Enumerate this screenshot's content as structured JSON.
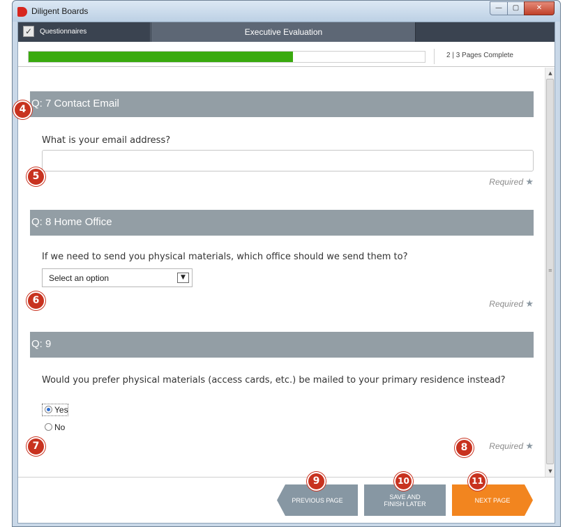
{
  "window": {
    "title": "Diligent Boards",
    "min_glyph": "—",
    "max_glyph": "▢",
    "close_glyph": "✕"
  },
  "navbar": {
    "section_label": "Questionnaires",
    "title": "Executive Evaluation",
    "check_glyph": "✓"
  },
  "progress": {
    "fraction_complete": 0.667,
    "label": "2 | 3   Pages Complete"
  },
  "questions": [
    {
      "header": "Q: 7  Contact Email",
      "prompt": "What is your email address?",
      "input_value": "",
      "required": "Required"
    },
    {
      "header": "Q: 8  Home Office",
      "prompt": "If we need to send you physical materials, which office should we send them to?",
      "select_value": "Select an option",
      "required": "Required"
    },
    {
      "header": "Q: 9",
      "prompt": "Would you prefer physical materials (access cards, etc.) be mailed to your primary residence instead?",
      "options": [
        "Yes",
        "No"
      ],
      "selected": "Yes",
      "required": "Required"
    }
  ],
  "required_star": "★",
  "buttons": {
    "previous": "PREVIOUS PAGE",
    "save_line1": "SAVE AND",
    "save_line2": "FINISH LATER",
    "next": "NEXT PAGE"
  },
  "callouts": [
    "4",
    "5",
    "6",
    "7",
    "8",
    "9",
    "10",
    "11"
  ],
  "colors": {
    "progress": "#3aaa0f",
    "header": "#939ea5",
    "navbar": "#3a4350",
    "next_button": "#f2851f",
    "nav_button": "#8797a3",
    "callout": "#c8321f"
  }
}
